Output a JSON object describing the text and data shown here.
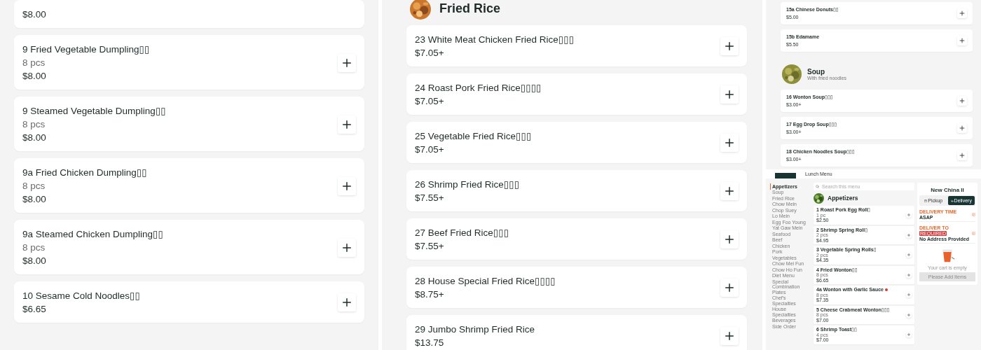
{
  "left_column": {
    "items": [
      {
        "price": "$8.00"
      },
      {
        "name": "9 Fried Vegetable Dumpling▯▯",
        "detail": "8 pcs",
        "price": "$8.00"
      },
      {
        "name": "9 Steamed Vegetable Dumpling▯▯",
        "detail": "8 pcs",
        "price": "$8.00"
      },
      {
        "name": "9a Fried Chicken Dumpling▯▯",
        "detail": "8 pcs",
        "price": "$8.00"
      },
      {
        "name": "9a Steamed Chicken Dumpling▯▯",
        "detail": "8 pcs",
        "price": "$8.00"
      },
      {
        "name": "10 Sesame Cold Noodles▯▯",
        "price": "$6.65"
      }
    ]
  },
  "middle_column": {
    "section": {
      "title": "Fried Rice"
    },
    "items": [
      {
        "name": "23 White Meat Chicken Fried Rice▯▯▯",
        "price": "$7.05+"
      },
      {
        "name": "24 Roast Pork Fried Rice▯▯▯▯",
        "price": "$7.05+"
      },
      {
        "name": "25 Vegetable Fried Rice▯▯▯",
        "price": "$7.05+"
      },
      {
        "name": "26 Shrimp Fried Rice▯▯▯",
        "price": "$7.55+"
      },
      {
        "name": "27 Beef Fried Rice▯▯▯",
        "price": "$7.55+"
      },
      {
        "name": "28 House Special Fried Rice▯▯▯▯",
        "price": "$8.75+"
      },
      {
        "name": "29 Jumbo Shrimp Fried Rice",
        "price": "$13.75"
      }
    ]
  },
  "right_top": {
    "items": [
      {
        "name": "15a Chinese Donuts▯▯",
        "price": "$5.00"
      },
      {
        "name": "15b Edamame",
        "price": "$5.50"
      }
    ],
    "section": {
      "title": "Soup",
      "subtitle": "With fried noodles"
    },
    "section_items": [
      {
        "name": "16 Wonton Soup▯▯▯",
        "price": "$3.00+"
      },
      {
        "name": "17 Egg Drop Soup▯▯▯",
        "price": "$3.00+"
      },
      {
        "name": "18 Chicken Noodles Soup▯▯▯",
        "price": "$3.00+"
      }
    ]
  },
  "site_preview": {
    "top_tabs": [
      {
        "selected": true
      },
      {
        "label": "Lunch Menu",
        "selected": false
      }
    ],
    "sidebar": [
      {
        "label": "Appetizers",
        "selected": true
      },
      {
        "label": "Soup",
        "selected": false
      },
      {
        "label": "Fried Rice",
        "selected": false
      },
      {
        "label": "Chow Mein",
        "selected": false
      },
      {
        "label": "Chop Suey",
        "selected": false
      },
      {
        "label": "Lo Mein",
        "selected": false
      },
      {
        "label": "Egg Foo Young",
        "selected": false
      },
      {
        "label": "Yat Gaw Mein",
        "selected": false
      },
      {
        "label": "Seafood",
        "selected": false
      },
      {
        "label": "Beef",
        "selected": false
      },
      {
        "label": "Chicken",
        "selected": false
      },
      {
        "label": "Pork",
        "selected": false
      },
      {
        "label": "Vegetables",
        "selected": false
      },
      {
        "label": "Chow Mei Fun",
        "selected": false
      },
      {
        "label": "Chow Ho Fun",
        "selected": false
      },
      {
        "label": "Diet Menu",
        "selected": false
      },
      {
        "label": "Special Combination Plates",
        "selected": false
      },
      {
        "label": "Chef's Specialties",
        "selected": false
      },
      {
        "label": "House Specialties",
        "selected": false
      },
      {
        "label": "Beverages",
        "selected": false
      },
      {
        "label": "Side Order",
        "selected": false
      }
    ],
    "search": {
      "placeholder": "Search this menu"
    },
    "section": {
      "title": "Appetizers"
    },
    "items": [
      {
        "name": "1 Roast Pork Egg Roll▯",
        "detail": "1 pc",
        "price": "$2.50",
        "spicy": false
      },
      {
        "name": "2 Shrimp Spring Roll▯",
        "detail": "2 pcs",
        "price": "$4.95",
        "spicy": false
      },
      {
        "name": "3 Vegetable Spring Rolls▯",
        "detail": "2 pcs",
        "price": "$4.35",
        "spicy": false
      },
      {
        "name": "4 Fried Wonton▯▯",
        "detail": "8 pcs",
        "price": "$6.65",
        "spicy": false
      },
      {
        "name": "4a Wonton with Garlic Sauce",
        "detail": "8 pcs",
        "price": "$7.35",
        "spicy": true
      },
      {
        "name": "5 Cheese Crabmeat Wonton▯▯▯",
        "detail": "8 pcs",
        "price": "$7.00",
        "spicy": false
      },
      {
        "name": "6 Shrimp Toast▯▯",
        "detail": "4 pcs",
        "price": "$7.00",
        "spicy": false
      }
    ],
    "cart": {
      "title": "New China II",
      "order_types": [
        {
          "label": "Pickup",
          "kind": "pickup",
          "selected": false
        },
        {
          "label": "Delivery",
          "kind": "delivery",
          "selected": true
        }
      ],
      "rows": [
        {
          "label": "DELIVERY TIME",
          "value": "ASAP"
        },
        {
          "label": "DELIVER TO",
          "badge": "REQUIRED",
          "value": "No Address Provided"
        }
      ],
      "empty_text": "Your cart is empty",
      "button": "Please Add Items"
    }
  }
}
